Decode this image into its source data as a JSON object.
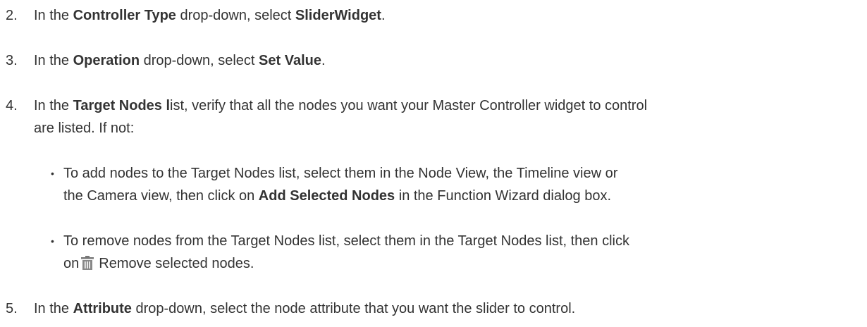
{
  "steps": [
    {
      "number": "2.",
      "pre": "In the ",
      "bold1": "Controller Type",
      "mid": " drop-down, select ",
      "bold2": "SliderWidget",
      "post": "."
    },
    {
      "number": "3.",
      "pre": "In the ",
      "bold1": "Operation",
      "mid": " drop-down, select ",
      "bold2": "Set Value",
      "post": "."
    },
    {
      "number": "4.",
      "pre": "In the ",
      "bold1": "Target Nodes l",
      "line1_rest": "ist, verify that all the nodes you want your Master Controller widget to control",
      "line2": "are listed. If not:"
    },
    {
      "number": "5.",
      "pre": "In the ",
      "bold1": "Attribute",
      "post": " drop-down, select the node attribute that you want the slider to control."
    }
  ],
  "bullets": [
    {
      "line1": "To add nodes to the Target Nodes list, select them in the Node View, the Timeline view or",
      "line2_pre": "the Camera view, then click on ",
      "line2_bold": "Add Selected Nodes",
      "line2_post": " in the Function Wizard dialog box."
    },
    {
      "line1": "To remove nodes from the Target Nodes list, select them in the Target Nodes list, then click",
      "line2_pre": "on",
      "icon": "trash-icon",
      "line2_post": "Remove selected nodes."
    }
  ],
  "bullet_glyph": "•"
}
